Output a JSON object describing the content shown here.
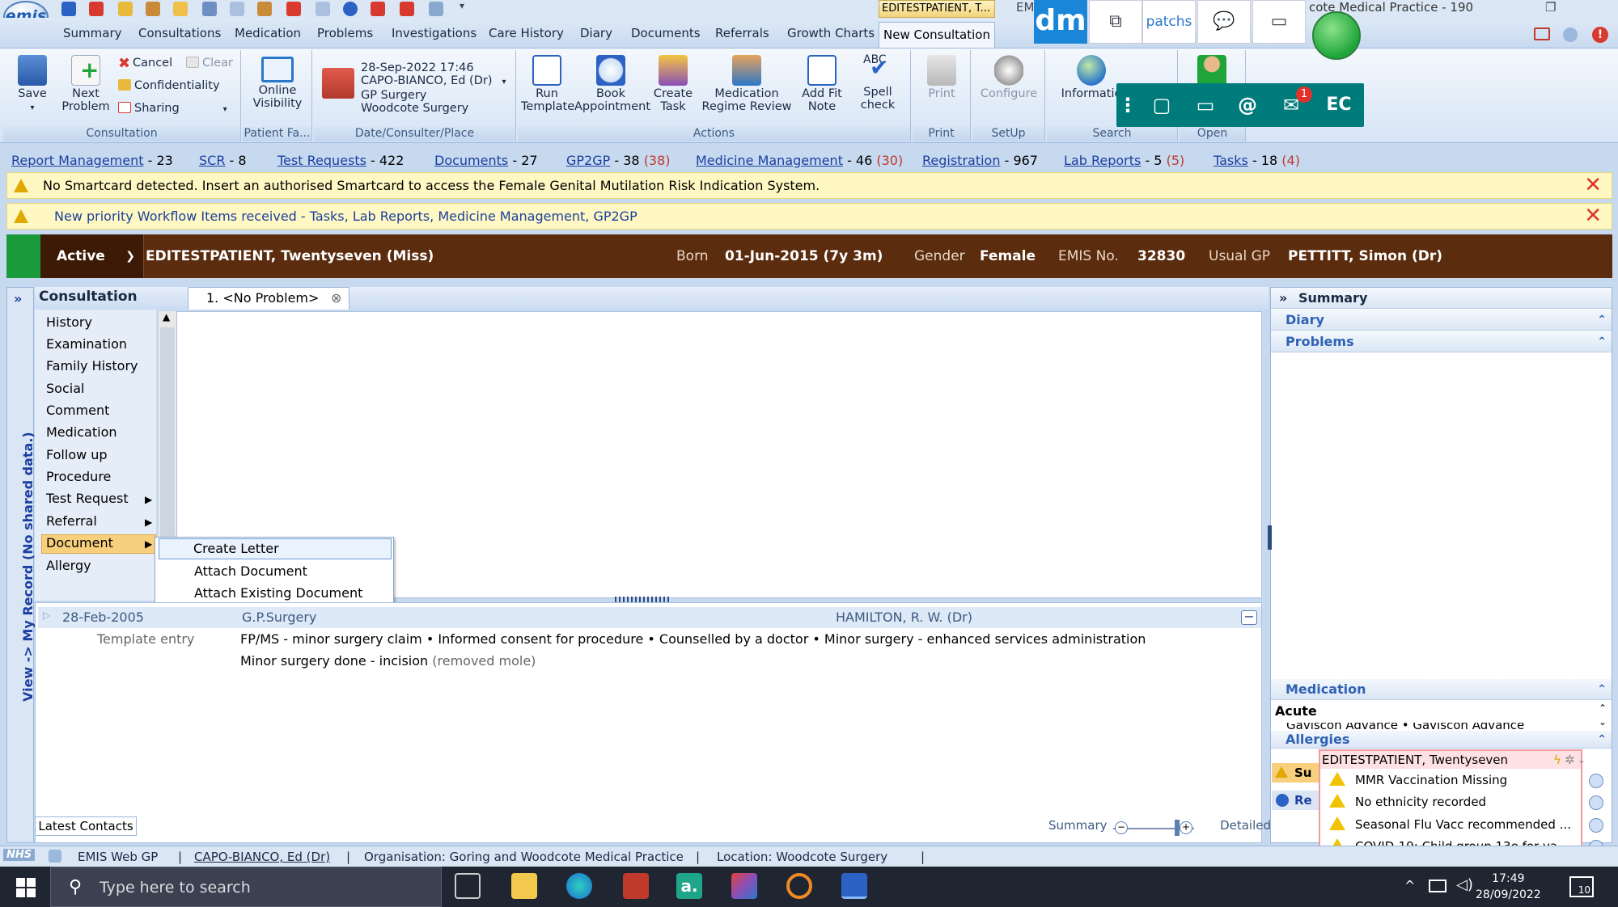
{
  "titlebar": {
    "context_tab": "EDITESTPATIENT, T...",
    "em": "EM",
    "practice_title": "cote Medical Practice - 190"
  },
  "ribbon_tabs": [
    "Summary",
    "Consultations",
    "Medication",
    "Problems",
    "Investigations",
    "Care History",
    "Diary",
    "Documents",
    "Referrals",
    "Growth Charts",
    "New Consultation"
  ],
  "ribbon": {
    "consultation": {
      "save": "Save",
      "next_problem_1": "Next",
      "next_problem_2": "Problem",
      "cancel": "Cancel",
      "clear": "Clear",
      "confidentiality": "Confidentiality",
      "sharing": "Sharing",
      "label": "Consultation"
    },
    "patient_facing": {
      "online_1": "Online",
      "online_2": "Visibility",
      "label": "Patient Fa..."
    },
    "date_place": {
      "date": "28-Sep-2022 17:46",
      "consulter": "CAPO-BIANCO, Ed (Dr)",
      "surgery": "GP Surgery",
      "place": "Woodcote Surgery",
      "label": "Date/Consulter/Place"
    },
    "actions": {
      "run_1": "Run",
      "run_2": "Template",
      "book_1": "Book",
      "book_2": "Appointment",
      "task_1": "Create",
      "task_2": "Task",
      "med_1": "Medication",
      "med_2": "Regime Review",
      "fit_1": "Add Fit",
      "fit_2": "Note",
      "spell_1": "Spell",
      "spell_2": "check",
      "abc": "ABC",
      "label": "Actions"
    },
    "print": {
      "btn": "Print",
      "label": "Print"
    },
    "setup": {
      "btn": "Configure",
      "label": "SetUp"
    },
    "search": {
      "btn": "Informatio",
      "label": "Search"
    },
    "open": {
      "label": "Open"
    }
  },
  "overlay": {
    "dm": "dm",
    "patchs": "patchs",
    "ec": "EC",
    "at": "@",
    "badge": "1"
  },
  "workflow": [
    {
      "name": "Report Management",
      "count": "- 23",
      "extra": ""
    },
    {
      "name": "SCR",
      "count": "- 8",
      "extra": ""
    },
    {
      "name": "Test Requests",
      "count": "- 422",
      "extra": ""
    },
    {
      "name": "Documents",
      "count": "- 27",
      "extra": ""
    },
    {
      "name": "GP2GP",
      "count": "- 38",
      "extra": "(38)"
    },
    {
      "name": "Medicine Management",
      "count": "- 46",
      "extra": "(30)"
    },
    {
      "name": "Registration",
      "count": "- 967",
      "extra": ""
    },
    {
      "name": "Lab Reports",
      "count": "- 5",
      "extra": "(5)"
    },
    {
      "name": "Tasks",
      "count": "- 18",
      "extra": "(4)"
    }
  ],
  "notices": [
    "No Smartcard detected. Insert an authorised Smartcard to access the Female Genital Mutilation Risk Indication System.",
    "New priority Workflow Items received - Tasks, Lab Reports, Medicine Management, GP2GP"
  ],
  "patient": {
    "status": "Active",
    "name": "EDITESTPATIENT,  Twentyseven  (Miss)",
    "born_label": "Born",
    "born": "01-Jun-2015 (7y 3m)",
    "gender_label": "Gender",
    "gender": "Female",
    "emis_label": "EMIS No.",
    "emis": "32830",
    "gp_label": "Usual GP",
    "gp": "PETTITT, Simon (Dr)"
  },
  "consultation": {
    "title": "Consultation",
    "problem_tab": "1. <No Problem>",
    "rail_text": "View -> My Record (No shared data.)",
    "menu": [
      "History",
      "Examination",
      "Family History",
      "Social",
      "Comment",
      "Medication",
      "Follow up",
      "Procedure",
      "Test Request",
      "Referral",
      "Document",
      "Allergy"
    ],
    "context_menu": [
      "Create Letter",
      "Attach Document",
      "Attach Existing Document"
    ]
  },
  "journal": {
    "date": "28-Feb-2005",
    "org": "G.P.Surgery",
    "clinician": "HAMILTON, R. W. (Dr)",
    "entry_label": "Template entry",
    "line1": "FP/MS - minor surgery claim  • Informed consent for procedure  • Counselled by a doctor  • Minor surgery - enhanced services administration",
    "line2a": "Minor surgery done - incision",
    "line2b": "(removed mole)",
    "latest_contacts": "Latest Contacts",
    "summary": "Summary",
    "detailed": "Detailed"
  },
  "right_panel": {
    "summary": "Summary",
    "diary": "Diary",
    "problems": "Problems",
    "medication": "Medication",
    "acute": "Acute",
    "gaviscon": "Gaviscon Advance  •  Gaviscon Advance",
    "allergies": "Allergies",
    "su": "Su",
    "re": "Re"
  },
  "alerts": {
    "header": "EDITESTPATIENT, Twentyseven",
    "items": [
      "MMR Vaccination Missing",
      "No ethnicity recorded",
      "Seasonal Flu Vacc recommended ...",
      "COVID-19: Child group 13e for va..."
    ]
  },
  "statusbar": {
    "nhs": "NHS",
    "app": "EMIS Web GP",
    "user": "CAPO-BIANCO, Ed (Dr)",
    "org": "Organisation: Goring and Woodcote Medical Practice",
    "location": "Location:  Woodcote Surgery"
  },
  "taskbar": {
    "search": "Type here to search",
    "time": "17:49",
    "date": "28/09/2022",
    "notif": "10"
  }
}
